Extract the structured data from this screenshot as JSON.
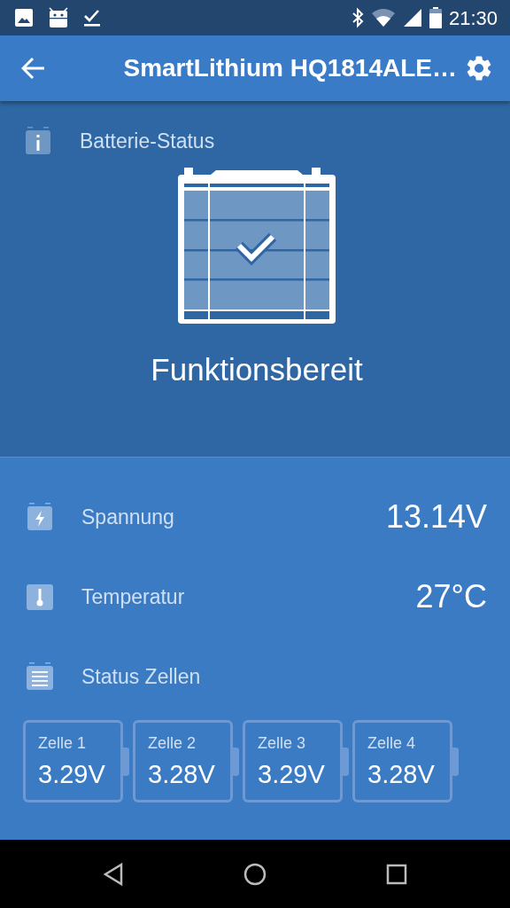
{
  "status_bar": {
    "time": "21:30"
  },
  "app_bar": {
    "title": "SmartLithium HQ1814ALE…"
  },
  "battery_status": {
    "label": "Batterie-Status",
    "state": "Funktionsbereit"
  },
  "readings": [
    {
      "kind": "voltage",
      "label": "Spannung",
      "value": "13.14V"
    },
    {
      "kind": "temperature",
      "label": "Temperatur",
      "value": "27°C"
    },
    {
      "kind": "cells",
      "label": "Status Zellen"
    }
  ],
  "cells": [
    {
      "label": "Zelle 1",
      "value": "3.29V"
    },
    {
      "label": "Zelle 2",
      "value": "3.28V"
    },
    {
      "label": "Zelle 3",
      "value": "3.29V"
    },
    {
      "label": "Zelle 4",
      "value": "3.28V"
    }
  ]
}
